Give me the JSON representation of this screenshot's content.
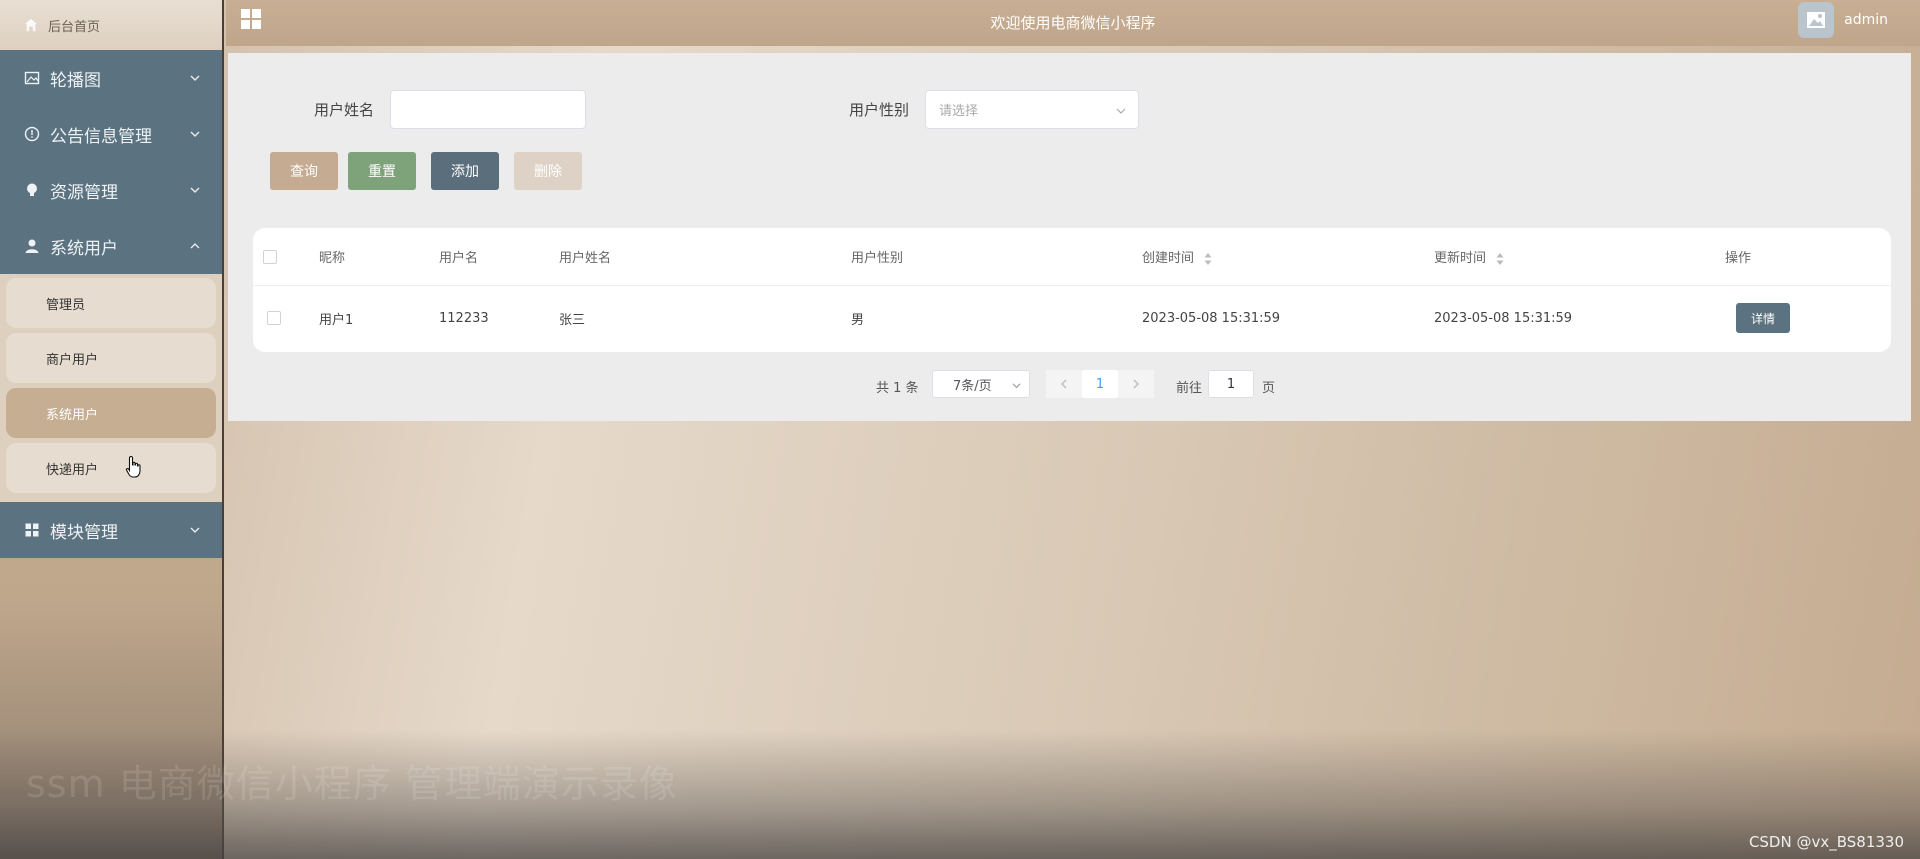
{
  "sidebar": {
    "home_label": "后台首页",
    "menus": [
      {
        "label": "轮播图",
        "icon": "image-icon"
      },
      {
        "label": "公告信息管理",
        "icon": "info-circle-icon"
      },
      {
        "label": "资源管理",
        "icon": "bulb-icon"
      },
      {
        "label": "系统用户",
        "icon": "user-icon"
      },
      {
        "label": "模块管理",
        "icon": "grid-icon"
      }
    ],
    "sub_items": [
      "管理员",
      "商户用户",
      "系统用户",
      "快递用户"
    ],
    "active_sub": "系统用户"
  },
  "topbar": {
    "title": "欢迎使用电商微信小程序",
    "username": "admin"
  },
  "search": {
    "name_label": "用户姓名",
    "name_value": "",
    "gender_label": "用户性别",
    "gender_placeholder": "请选择"
  },
  "buttons": {
    "query": "查询",
    "reset": "重置",
    "add": "添加",
    "delete": "删除"
  },
  "colors": {
    "query": "#c4ab92",
    "reset": "#7ea27a",
    "add": "#5b6e7c",
    "delete": "#ddd2c5",
    "sidebar_menu": "#5b7281"
  },
  "table": {
    "headers": [
      "昵称",
      "用户名",
      "用户姓名",
      "用户性别",
      "创建时间",
      "更新时间",
      "操作"
    ],
    "rows": [
      {
        "nickname": "用户1",
        "username": "112233",
        "realname": "张三",
        "gender": "男",
        "created": "2023-05-08 15:31:59",
        "updated": "2023-05-08 15:31:59",
        "action": "详情"
      }
    ]
  },
  "pager": {
    "total": "共 1 条",
    "page_size": "7条/页",
    "current": "1",
    "goto_label": "前往",
    "goto_value": "1",
    "page_suffix": "页"
  },
  "overlay": {
    "video_title": "ssm 电商微信小程序 管理端演示录像",
    "credit": "CSDN @vx_BS81330"
  }
}
